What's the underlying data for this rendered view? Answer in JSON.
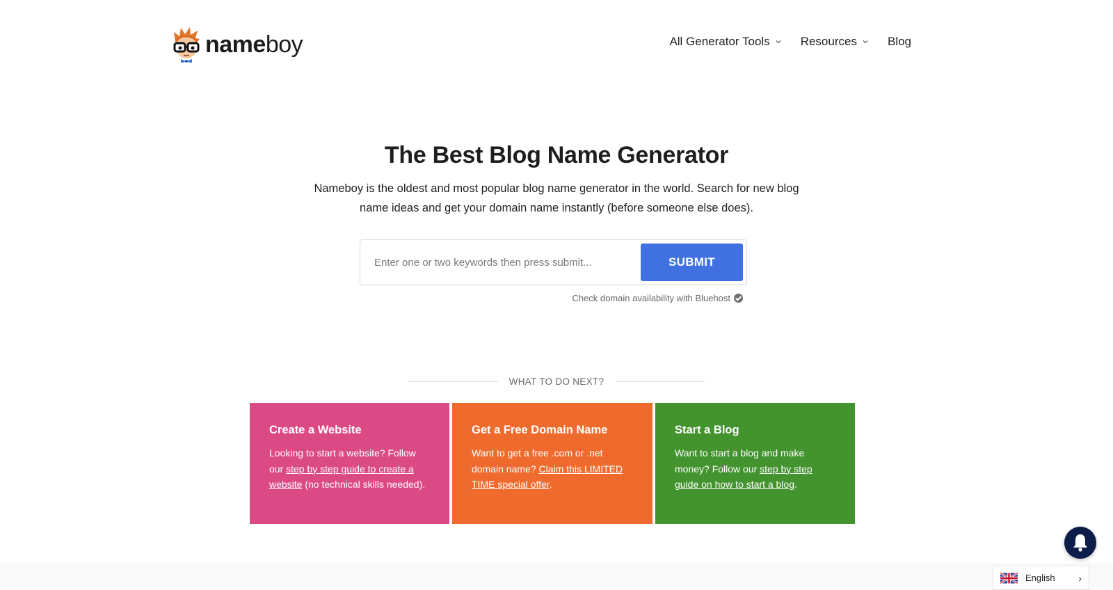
{
  "header": {
    "logo": {
      "bold": "name",
      "regular": "boy",
      "mascot_icon": "nerd-boy-mascot"
    },
    "nav": [
      {
        "label": "All Generator Tools",
        "has_dropdown": true
      },
      {
        "label": "Resources",
        "has_dropdown": true
      },
      {
        "label": "Blog",
        "has_dropdown": false
      }
    ]
  },
  "hero": {
    "title": "The Best Blog Name Generator",
    "description": "Nameboy is the oldest and most popular blog name generator in the world. Search for new blog name ideas and get your domain name instantly (before someone else does)."
  },
  "search": {
    "placeholder": "Enter one or two keywords then press submit...",
    "value": "",
    "submit_label": "SUBMIT",
    "check_text": "Check domain availability with Bluehost",
    "check_icon": "check-circle"
  },
  "next": {
    "label": "WHAT TO DO NEXT?",
    "cards": [
      {
        "title": "Create a Website",
        "text_before": "Looking to start a website? Follow our ",
        "link": "step by step guide to create a website",
        "text_after": " (no technical skills needed).",
        "color": "#dc4a86"
      },
      {
        "title": "Get a Free Domain Name",
        "text_before": "Want to get a free .com or .net domain name? ",
        "link": "Claim this LIMITED TIME special offer",
        "text_after": ".",
        "color": "#ef6b2d"
      },
      {
        "title": "Start a Blog",
        "text_before": "Want to start a blog and make money? Follow our ",
        "link": "step by step guide on how to start a blog",
        "text_after": ".",
        "color": "#43932e"
      }
    ]
  },
  "widgets": {
    "notification_icon": "bell",
    "language": {
      "label": "English",
      "flag_icon": "uk-flag",
      "arrow": "›"
    }
  },
  "colors": {
    "accent": "#4170e0",
    "bell_bg": "#0b1d48",
    "footer_bg": "#f9f9f9"
  }
}
